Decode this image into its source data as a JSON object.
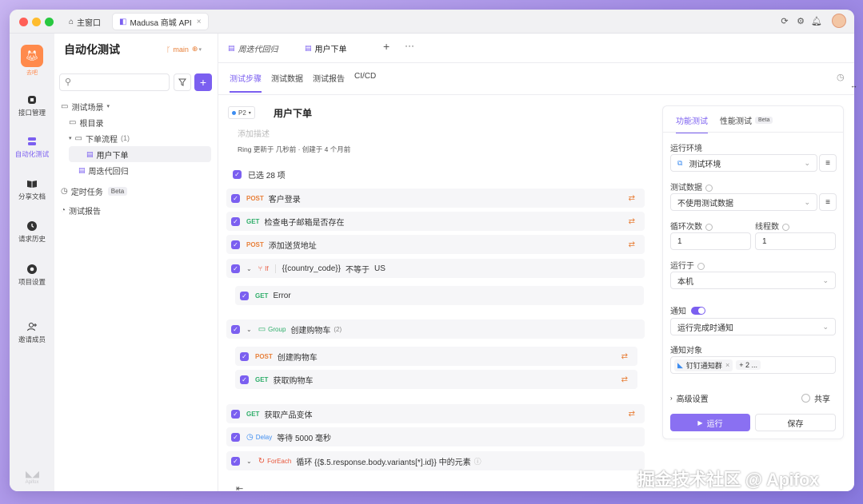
{
  "window": {
    "tabs": [
      {
        "label": "主窗口"
      },
      {
        "label": "Madusa 商城 API"
      }
    ]
  },
  "rail": {
    "logo_label": "去吧",
    "items": [
      {
        "label": "接口管理",
        "icon": "api-icon"
      },
      {
        "label": "自动化测试",
        "icon": "automation-icon"
      },
      {
        "label": "分享文档",
        "icon": "book-icon"
      },
      {
        "label": "请求历史",
        "icon": "clock-icon"
      },
      {
        "label": "项目设置",
        "icon": "gear-icon"
      },
      {
        "label": "邀请成员",
        "icon": "user-add-icon"
      }
    ],
    "bottom_label": "Apifox"
  },
  "sidebar": {
    "title": "自动化测试",
    "branch": "main",
    "search_placeholder": "",
    "tree": [
      {
        "label": "测试场景",
        "level": 0
      },
      {
        "label": "根目录",
        "level": 1
      },
      {
        "label": "下单流程",
        "count": "(1)",
        "level": 1
      },
      {
        "label": "用户下单",
        "level": 2
      },
      {
        "label": "周迭代回归",
        "level": 1
      }
    ],
    "scheduled": {
      "label": "定时任务",
      "badge": "Beta"
    },
    "report": {
      "label": "测试报告"
    }
  },
  "main": {
    "doc_tabs": [
      {
        "label": "周迭代回归"
      },
      {
        "label": "用户下单"
      }
    ],
    "sub_tabs": [
      "测试步骤",
      "测试数据",
      "测试报告",
      "CI/CD"
    ],
    "priority": "P2",
    "title": "用户下单",
    "desc_placeholder": "添加描述",
    "meta": "Ring 更新于 几秒前 · 创建于 4 个月前",
    "selected": "已选 28 项",
    "steps": [
      {
        "method": "POST",
        "name": "客户登录"
      },
      {
        "method": "GET",
        "name": "检查电子邮箱是否存在"
      },
      {
        "method": "POST",
        "name": "添加送货地址"
      },
      {
        "kind": "If",
        "var": "{{country_code}}",
        "op": "不等于",
        "value": "US"
      },
      {
        "method": "GET",
        "name": "Error"
      },
      {
        "kind": "Group",
        "name": "创建购物车",
        "count": "(2)"
      },
      {
        "method": "POST",
        "name": "创建购物车"
      },
      {
        "method": "GET",
        "name": "获取购物车"
      },
      {
        "method": "GET",
        "name": "获取产品变体"
      },
      {
        "kind": "Delay",
        "name": "等待 5000 毫秒"
      },
      {
        "kind": "ForEach",
        "name": "循环 {{$.5.response.body.variants[*].id}} 中的元素"
      }
    ]
  },
  "panel": {
    "tabs": [
      "功能测试",
      "性能测试"
    ],
    "perf_badge": "Beta",
    "env_label": "运行环境",
    "env_value": "测试环境",
    "data_label": "测试数据",
    "data_value": "不使用测试数据",
    "loop_label": "循环次数",
    "loop_value": "1",
    "thread_label": "线程数",
    "thread_value": "1",
    "runon_label": "运行于",
    "runon_value": "本机",
    "notify_label": "通知",
    "notify_value": "运行完成时通知",
    "target_label": "通知对象",
    "target_chip": "钉钉通知群",
    "target_more": "+ 2 ...",
    "advanced": "高级设置",
    "share": "共享",
    "run": "运行",
    "save": "保存"
  },
  "watermark": "掘金技术社区 @ Apifox",
  "colors": {
    "accent": "#7b5ff0",
    "post": "#e8803a",
    "get": "#2fae6a"
  }
}
